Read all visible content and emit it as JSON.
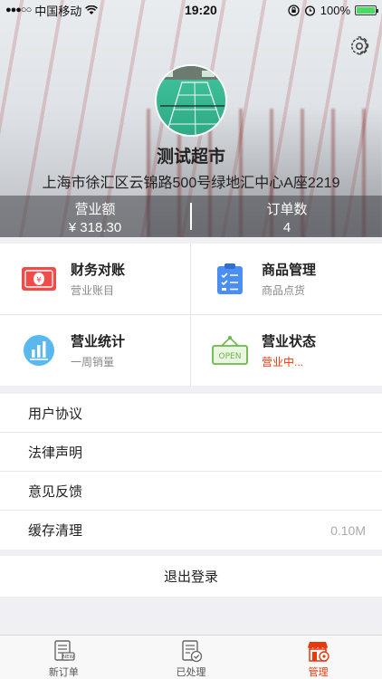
{
  "status_bar": {
    "carrier": "中国移动",
    "time": "19:20",
    "battery": "100%"
  },
  "header": {
    "shop_name": "测试超市",
    "address": "上海市徐汇区云锦路500号绿地汇中心A座2219",
    "stats": [
      {
        "label": "营业额",
        "value": "¥ 318.30"
      },
      {
        "label": "订单数",
        "value": "4"
      }
    ]
  },
  "grid": [
    {
      "title": "财务对账",
      "subtitle": "营业账目",
      "icon": "money-icon"
    },
    {
      "title": "商品管理",
      "subtitle": "商品点货",
      "icon": "clipboard-icon"
    },
    {
      "title": "营业统计",
      "subtitle": "一周销量",
      "icon": "chart-icon"
    },
    {
      "title": "营业状态",
      "subtitle": "营业中...",
      "icon": "open-sign-icon"
    }
  ],
  "list": [
    {
      "label": "用户协议",
      "value": ""
    },
    {
      "label": "法律声明",
      "value": ""
    },
    {
      "label": "意见反馈",
      "value": ""
    },
    {
      "label": "缓存清理",
      "value": "0.10M"
    }
  ],
  "logout_label": "退出登录",
  "tabs": [
    {
      "label": "新订单",
      "icon": "new-order-icon"
    },
    {
      "label": "已处理",
      "icon": "processed-icon"
    },
    {
      "label": "管理",
      "icon": "store-manage-icon",
      "active": true
    }
  ],
  "colors": {
    "accent": "#e8380d",
    "background": "#efeff4"
  }
}
